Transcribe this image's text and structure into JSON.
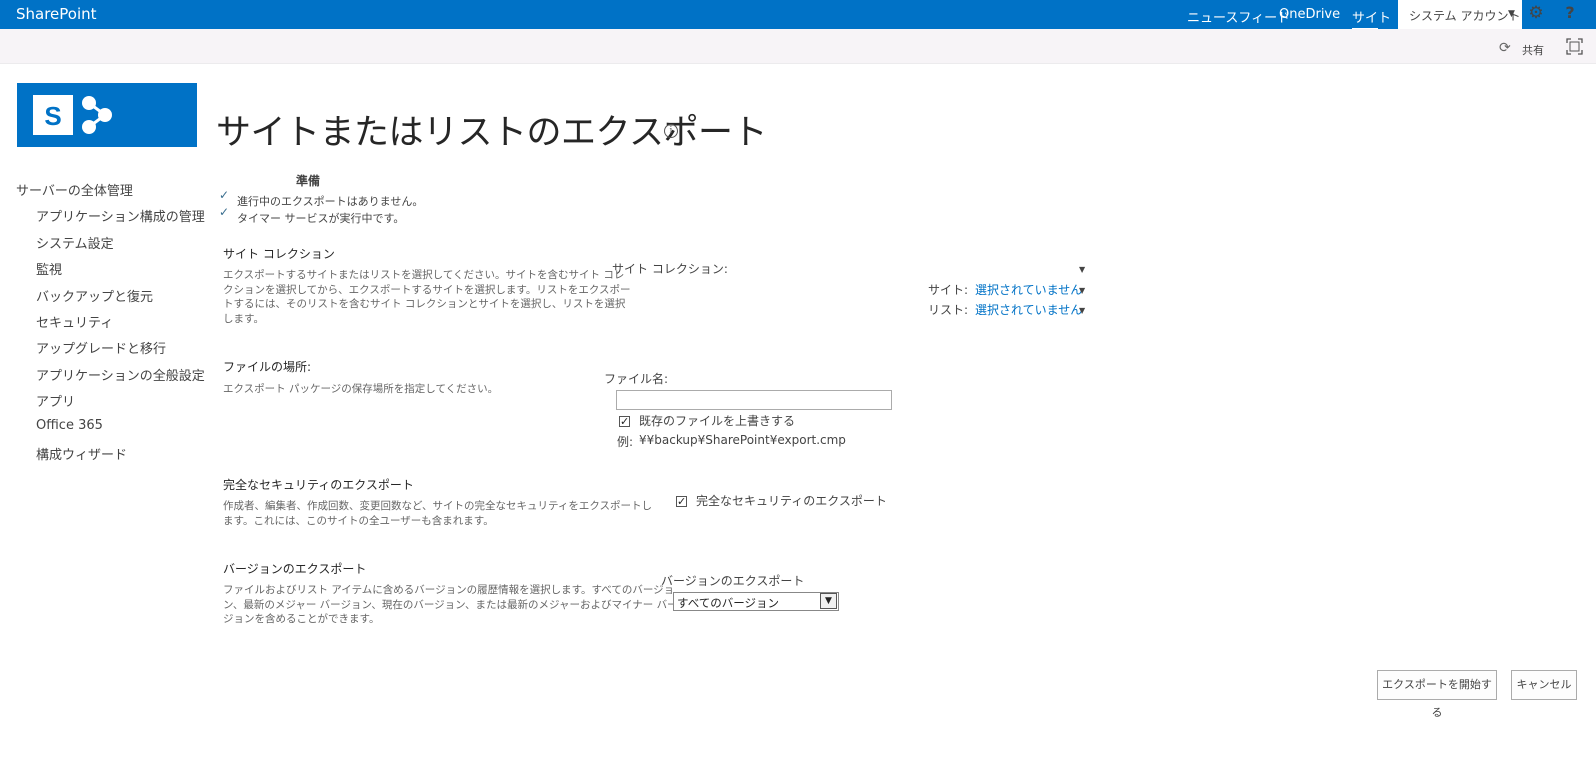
{
  "suite_bar": {
    "brand": "SharePoint",
    "nav": [
      "ニュースフィード",
      "OneDrive",
      "サイト"
    ],
    "account": "システム アカウント",
    "gear_icon": "gear-icon",
    "help_label": "?"
  },
  "ribbon": {
    "share_label": "共有",
    "share_icon": "sync-share-icon",
    "focus_icon": "focus-on-content-icon"
  },
  "page": {
    "title": "サイトまたはリストのエクスポート"
  },
  "left_nav": {
    "header": "サーバーの全体管理",
    "items": [
      "アプリケーション構成の管理",
      "システム設定",
      "監視",
      "バックアップと復元",
      "セキュリティ",
      "アップグレードと移行",
      "アプリケーションの全般設定",
      "アプリ",
      "Office 365",
      "構成ウィザード"
    ]
  },
  "status": {
    "title": "準備",
    "items": [
      "進行中のエクスポートはありません。",
      "タイマー サービスが実行中です。"
    ]
  },
  "sections": {
    "site_collection": {
      "heading": "サイト コレクション",
      "desc": [
        "エクスポートするサイトまたはリストを選択してください。サイトを含むサイト コレ",
        "クションを選択してから、エクスポートするサイトを選択します。リストをエクスポー",
        "トするには、そのリストを含むサイト コレクションとサイトを選択し、リストを選択",
        "します。"
      ],
      "collection_label": "サイト コレクション:",
      "site_label": "サイト:",
      "site_value": "選択されていません",
      "list_label": "リスト:",
      "list_value": "選択されていません"
    },
    "file_location": {
      "heading": "ファイルの場所:",
      "desc": "エクスポート パッケージの保存場所を指定してください。",
      "filename_label": "ファイル名:",
      "filename_value": "",
      "overwrite_label": "既存のファイルを上書きする",
      "overwrite_checked": true,
      "example_label": "例:",
      "example_value": "¥¥backup¥SharePoint¥export.cmp"
    },
    "security": {
      "heading": "完全なセキュリティのエクスポート",
      "desc": [
        "作成者、編集者、作成回数、変更回数など、サイトの完全なセキュリティをエクスポートし",
        "ます。これには、このサイトの全ユーザーも含まれます。"
      ],
      "checkbox_label": "完全なセキュリティのエクスポート",
      "checked": true
    },
    "versions": {
      "heading": "バージョンのエクスポート",
      "desc": [
        "ファイルおよびリスト アイテムに含めるバージョンの履歴情報を選択します。すべてのバージョ",
        "ン、最新のメジャー バージョン、現在のバージョン、または最新のメジャーおよびマイナー バー",
        "ジョンを含めることができます。"
      ],
      "select_label": "バージョンのエクスポート",
      "selected": "すべてのバージョン"
    }
  },
  "buttons": {
    "start": "エクスポートを開始する",
    "cancel": "キャンセル"
  },
  "colors": {
    "suite_bar": "#0072c6",
    "link": "#0072c6",
    "ribbon": "#f7f4f7"
  }
}
